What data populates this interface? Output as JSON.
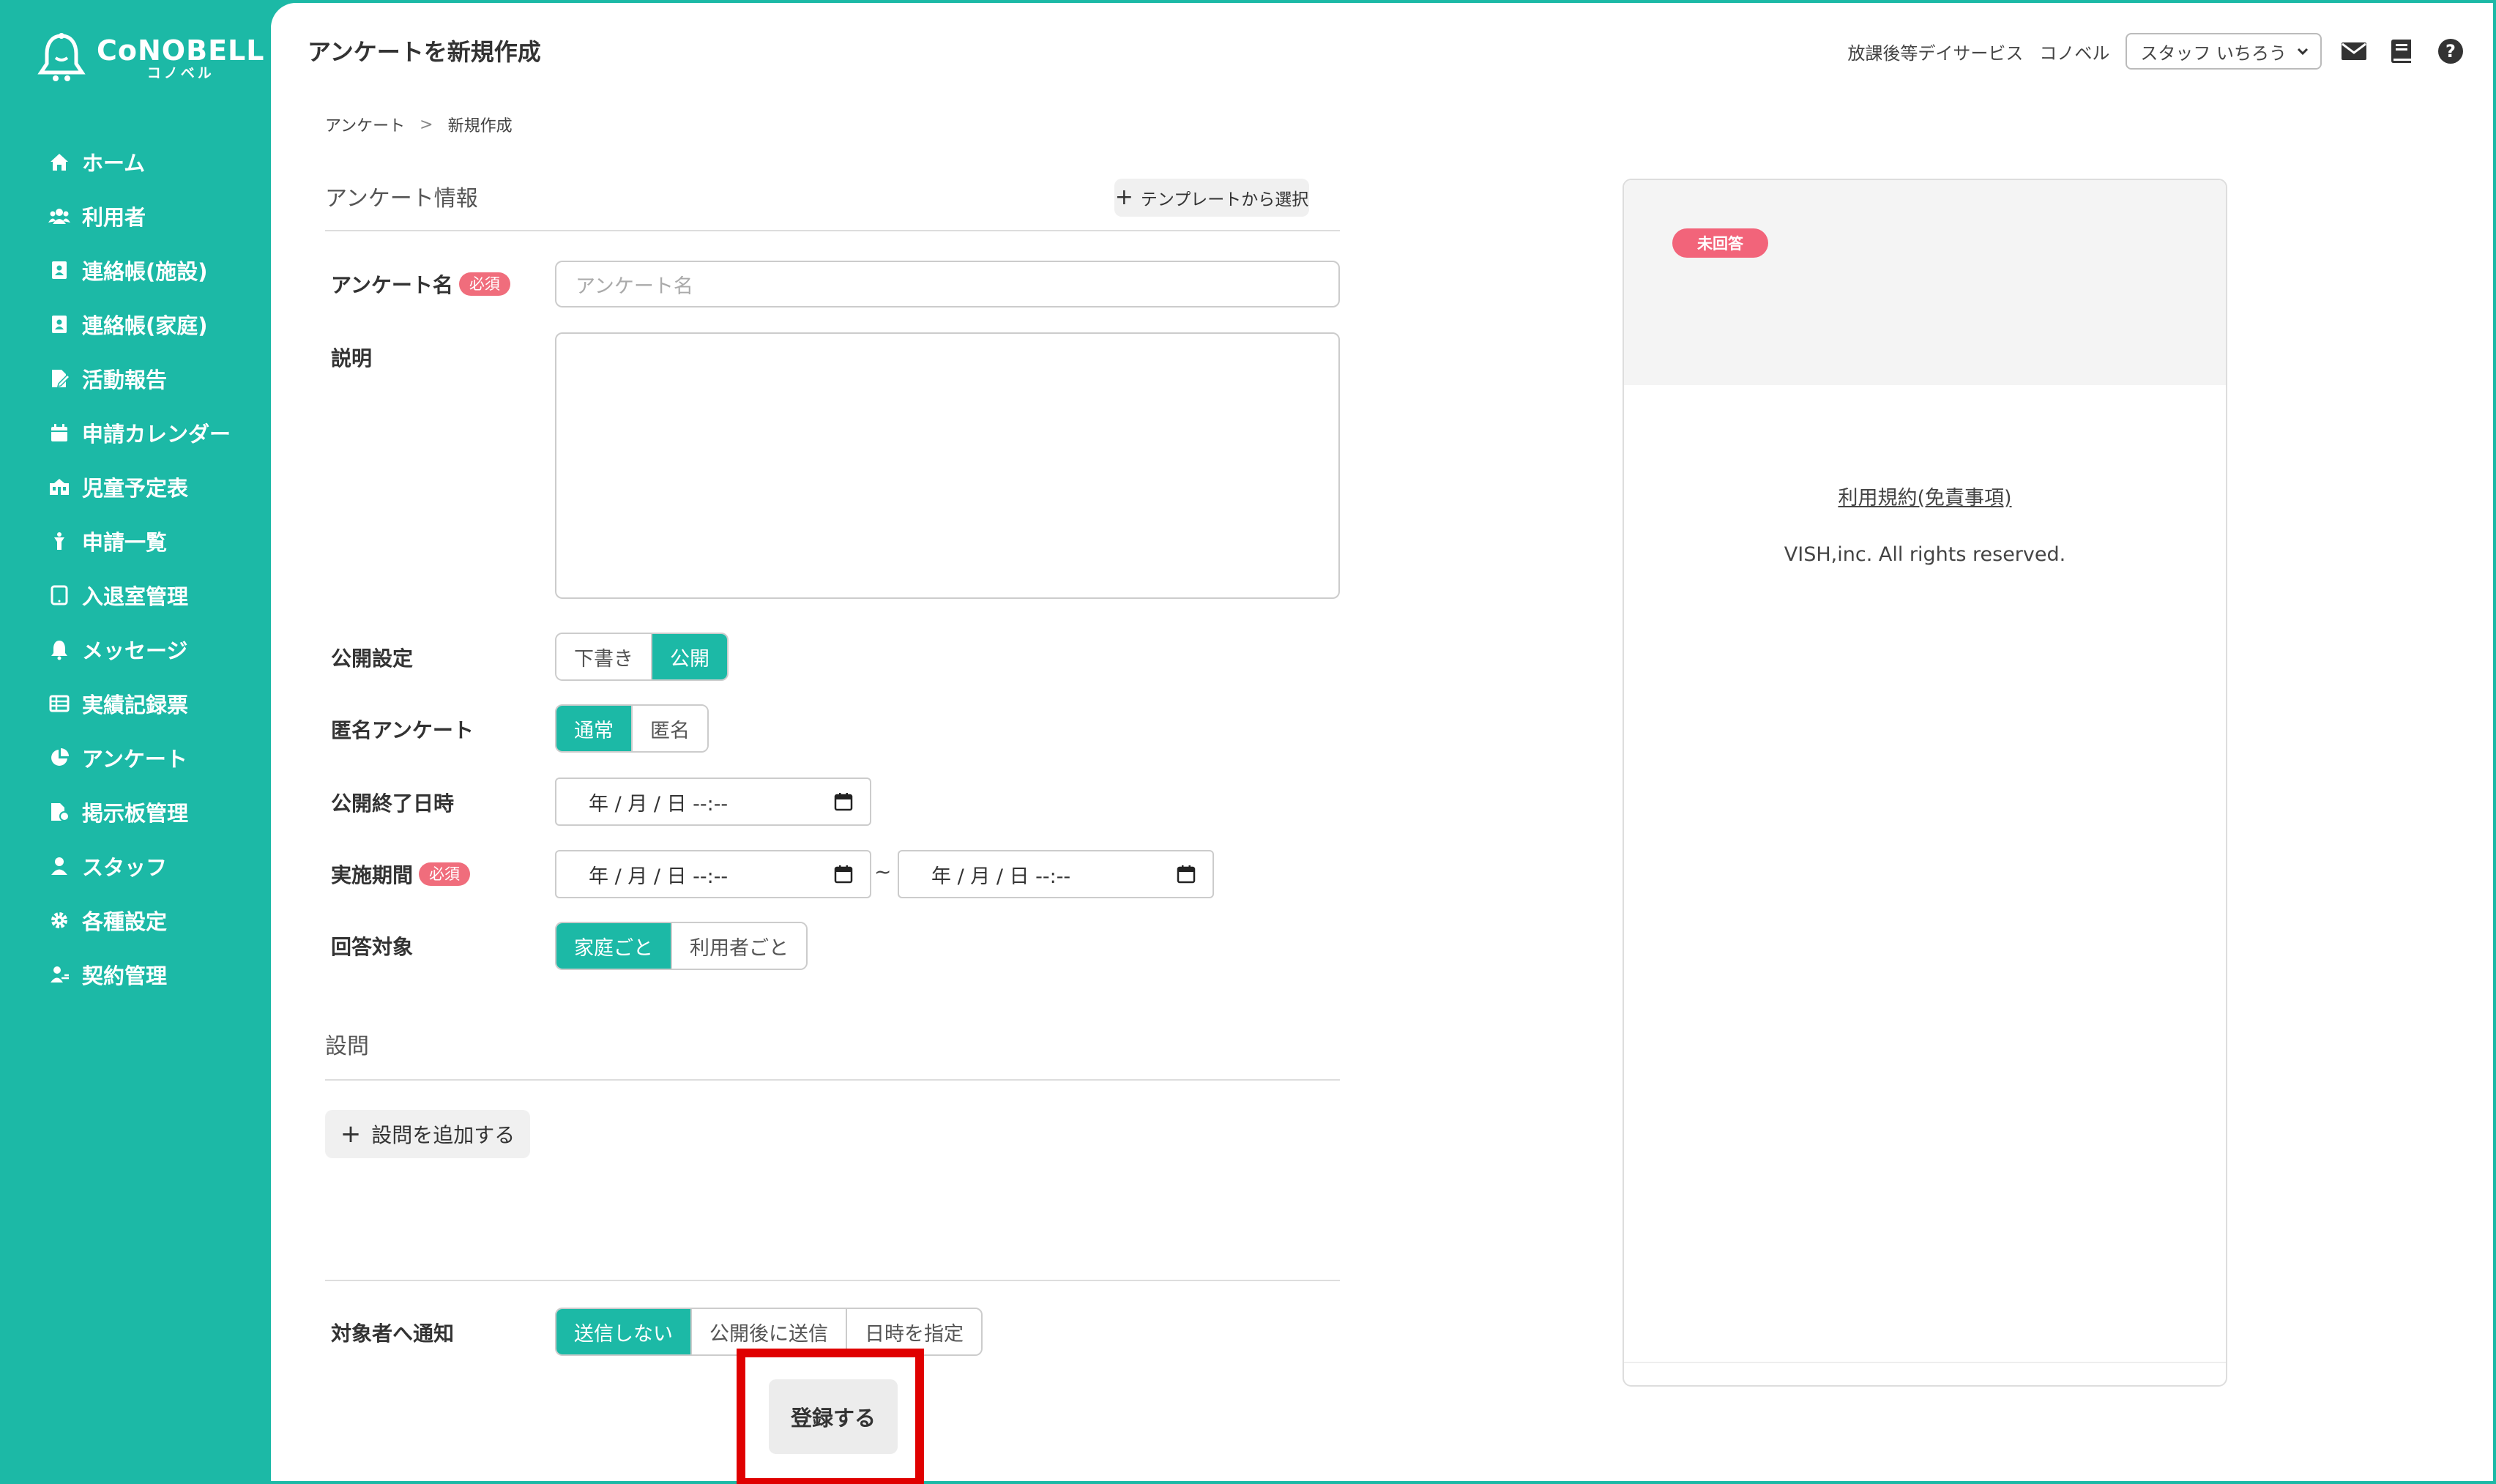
{
  "brand": {
    "name": "CoNOBELL",
    "sub": "コノベル",
    "color_primary": "#1cb9a6"
  },
  "sidebar": {
    "items": [
      {
        "label": "ホーム",
        "icon": "home-icon"
      },
      {
        "label": "利用者",
        "icon": "users-icon"
      },
      {
        "label": "連絡帳(施設)",
        "icon": "contact-book-icon"
      },
      {
        "label": "連絡帳(家庭)",
        "icon": "contact-book-icon"
      },
      {
        "label": "活動報告",
        "icon": "report-icon"
      },
      {
        "label": "申請カレンダー",
        "icon": "calendar-icon"
      },
      {
        "label": "児童予定表",
        "icon": "schedule-icon"
      },
      {
        "label": "申請一覧",
        "icon": "request-icon"
      },
      {
        "label": "入退室管理",
        "icon": "tablet-icon"
      },
      {
        "label": "メッセージ",
        "icon": "bell-icon"
      },
      {
        "label": "実績記録票",
        "icon": "table-icon"
      },
      {
        "label": "アンケート",
        "icon": "pie-chart-icon"
      },
      {
        "label": "掲示板管理",
        "icon": "board-icon"
      },
      {
        "label": "スタッフ",
        "icon": "staff-icon"
      },
      {
        "label": "各種設定",
        "icon": "gear-icon"
      },
      {
        "label": "契約管理",
        "icon": "contract-icon"
      }
    ]
  },
  "header": {
    "title": "アンケートを新規作成",
    "facility": "放課後等デイサービス",
    "service": "コノベル",
    "staff_select": "スタッフ いちろう",
    "icons": [
      "mail-icon",
      "book-icon",
      "help-icon"
    ]
  },
  "breadcrumb": {
    "items": [
      "アンケート",
      "新規作成"
    ],
    "separator": ">"
  },
  "form": {
    "section_info": "アンケート情報",
    "template_button": "テンプレートから選択",
    "name_label": "アンケート名",
    "required_badge": "必須",
    "name_placeholder": "アンケート名",
    "description_label": "説明",
    "publish_label": "公開設定",
    "publish_options": [
      "下書き",
      "公開"
    ],
    "publish_selected": "公開",
    "anonymous_label": "匿名アンケート",
    "anonymous_options": [
      "通常",
      "匿名"
    ],
    "anonymous_selected": "通常",
    "end_label": "公開終了日時",
    "datetime_placeholder": "年 / 月 / 日 --:--",
    "period_label": "実施期間",
    "period_separator": "~",
    "target_label": "回答対象",
    "target_options": [
      "家庭ごと",
      "利用者ごと"
    ],
    "target_selected": "家庭ごと",
    "section_questions": "設問",
    "add_question_button": "設問を追加する",
    "notify_label": "対象者へ通知",
    "notify_options": [
      "送信しない",
      "公開後に送信",
      "日時を指定"
    ],
    "notify_selected": "送信しない",
    "submit_button": "登録する"
  },
  "preview": {
    "status_badge": "未回答",
    "terms_link": "利用規約(免責事項)",
    "copyright": "VISH,inc. All rights reserved."
  }
}
